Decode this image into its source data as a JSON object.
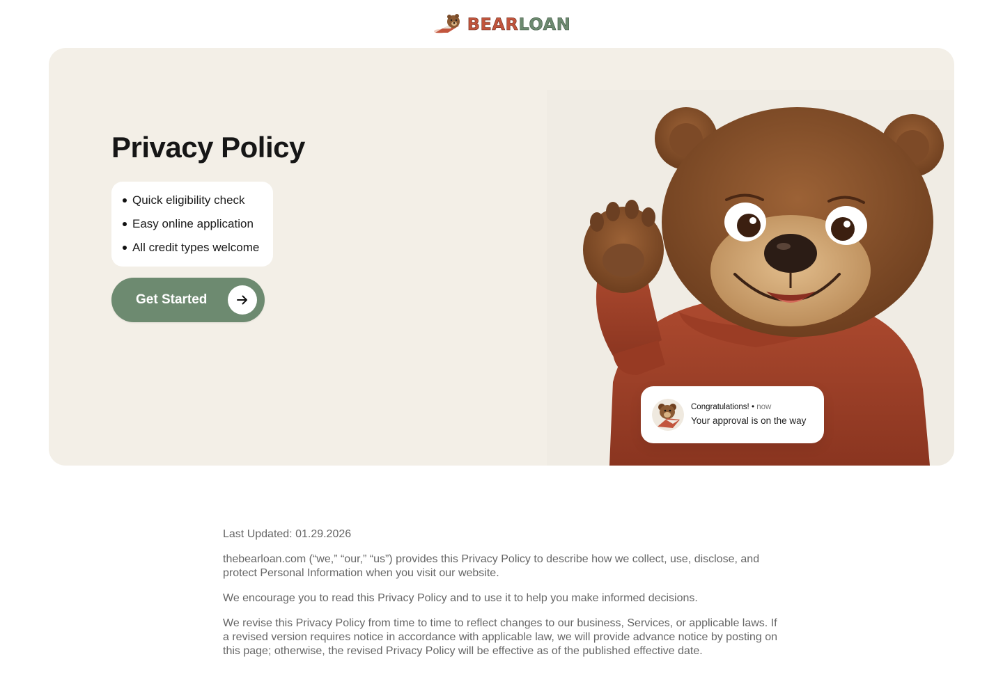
{
  "header": {
    "logo_part1": "BEAR",
    "logo_part2": "LOAN"
  },
  "hero": {
    "title": "Privacy Policy",
    "features": [
      "Quick eligibility check",
      "Easy online application",
      "All credit types welcome"
    ],
    "cta_label": "Get Started",
    "cta_icon": "arrow-right-icon",
    "illustration": "waving-bear-in-sweater",
    "notification": {
      "title": "Congratulations! ",
      "separator": " • ",
      "time": "now",
      "body": "Your approval is on the way"
    }
  },
  "content": {
    "last_updated": "Last Updated: 01.29.2026",
    "paragraphs": [
      "thebearloan.com (“we,” “our,” “us”) provides this Privacy Policy to describe how we collect, use, disclose, and protect Personal Information when you visit our website.",
      "We encourage you to read this Privacy Policy and to use it to help you make informed decisions.",
      "We revise this Privacy Policy from time to time to reflect changes to our business, Services, or applicable laws. If a revised version requires notice in accordance with applicable law, we will provide advance notice by posting on this page; otherwise, the revised Privacy Policy will be effective as of the published effective date."
    ]
  },
  "colors": {
    "accent_green": "#6d8a70",
    "brand_red": "#c2553d",
    "hero_bg": "#f3efe7",
    "body_text": "#666666"
  }
}
